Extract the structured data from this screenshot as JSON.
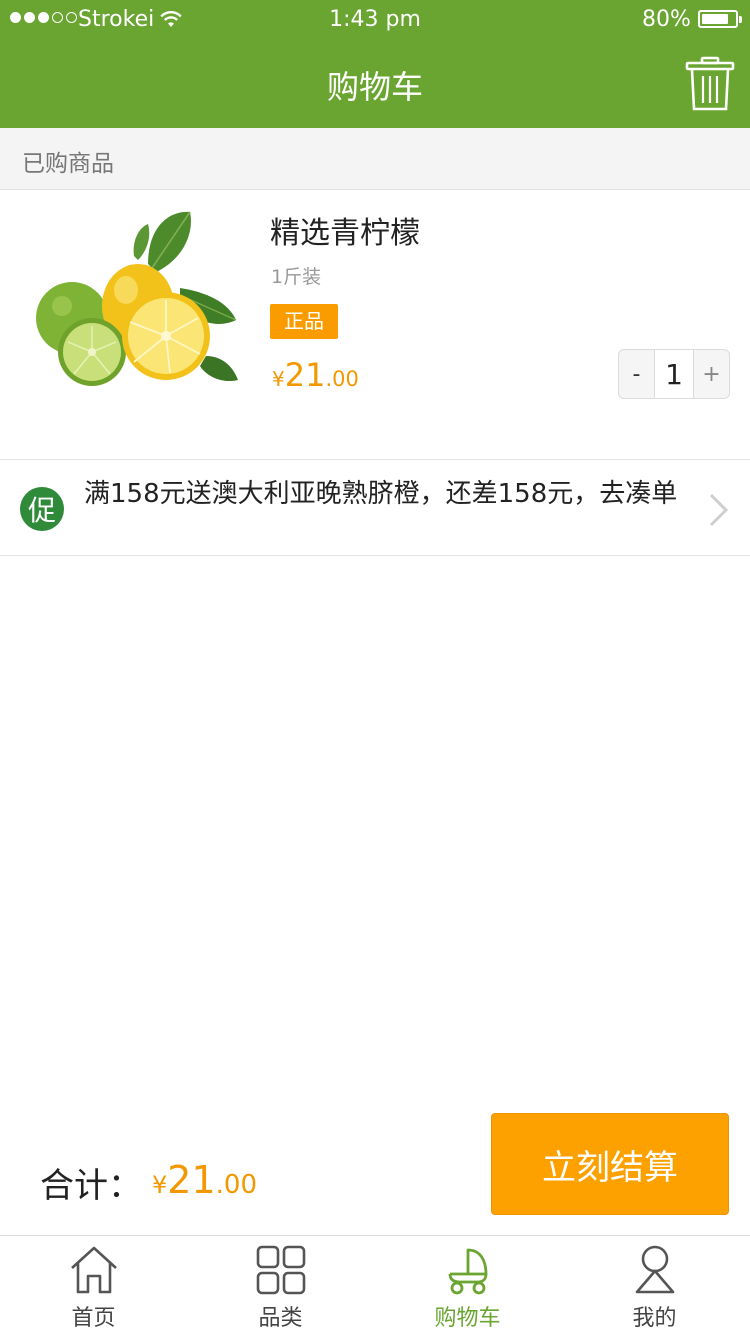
{
  "status_bar": {
    "carrier": "Strokei",
    "time": "1:43 pm",
    "battery_percent": "80%",
    "battery_level": 0.8,
    "signal_bars_filled": 3,
    "signal_bars_total": 5
  },
  "nav": {
    "title": "购物车",
    "trash_icon": "trash-icon"
  },
  "section": {
    "label": "已购商品"
  },
  "cart_item": {
    "name": "精选青柠檬",
    "spec": "1斤装",
    "badge": "正品",
    "price_symbol": "¥",
    "price_int": "21",
    "price_dec": ".00",
    "quantity": "1",
    "decrement_label": "-",
    "increment_label": "+"
  },
  "promo": {
    "badge": "促",
    "text": "满158元送澳大利亚晚熟脐橙，还差158元，去凑单"
  },
  "total": {
    "label": "合计：",
    "price_symbol": "¥",
    "price_int": "21",
    "price_dec": ".00",
    "checkout_label": "立刻结算"
  },
  "tabs": [
    {
      "label": "首页",
      "icon": "home-icon",
      "active": false
    },
    {
      "label": "品类",
      "icon": "grid-icon",
      "active": false
    },
    {
      "label": "购物车",
      "icon": "cart-icon",
      "active": true
    },
    {
      "label": "我的",
      "icon": "user-icon",
      "active": false
    }
  ],
  "colors": {
    "brand_green": "#6aa532",
    "price_orange": "#f39800",
    "checkout_orange": "#fca100",
    "promo_green": "#2f8a3a"
  }
}
